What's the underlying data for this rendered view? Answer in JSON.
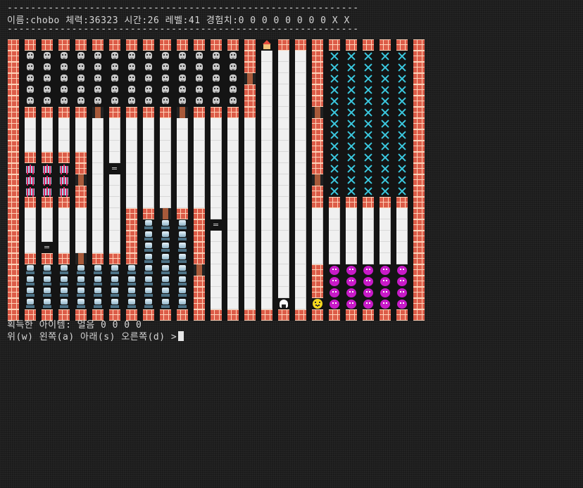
{
  "terminal": {
    "separator": "------------------------------------------------------------",
    "status_line": "이름:chobo 체력:36323 시간:26 레벨:41 경험치:0 0 0 0 0 0 0 0 X X",
    "items_line": "획득한 아이템: 얼음 0 0 0 0",
    "prompt": "위(w) 왼쪽(a) 아래(s) 오른쪽(d) >"
  },
  "legend": {
    "W": "brick-wall-icon",
    "F": "floor-tile",
    ".": "empty-dark",
    "D": "door-icon",
    "K": "skull-icon",
    "G": "gift-icon",
    "L": "lamp-icon",
    "X": "sword-icon",
    "M": "devil-icon",
    "P": "smiley-player-icon",
    "R": "rice-ball-icon",
    "H": "house-icon",
    "S": "sign-icon"
  },
  "colors": {
    "background": "#1d1d1d",
    "text": "#d6d6d6",
    "brick": "#dc5c48",
    "devil": "#c81ac8",
    "sword": "#3bc9e0",
    "player": "#f5d81e"
  },
  "map": [
    "WWWWWWWWWWWWWWWHWWWWWWWWW",
    "WKKKKKKKKKKKKKWFFFWXXXXXW",
    "WKKKKKKKKKKKKKWFFFWXXXXXW",
    "WKKKKKKKKKKKKKDFFFWXXXXXW",
    "WKKKKKKKKKKKKKWFFFWXXXXXW",
    "WKKKKKKKKKKKKKWFFFWXXXXXW",
    "WWWWWDWWWWDWWWWFFFDXXXXXW",
    "WFFFFFFFFFFFFFFFFFWXXXXXW",
    "WFFFFFFFFFFFFFFFFFWXXXXXW",
    "WFFFFFFFFFFFFFFFFFWXXXXXW",
    "WWWWWFFFFFFFFFFFFFWXXXXXW",
    "WGGGWFSFFFFFFFFFFFWXXXXXW",
    "WGGGDFFFFFFFFFFFFFDXXXXXW",
    "WGGGWFFFFFFFFFFFFFWXXXXXW",
    "WWWWWFFFFFFFFFFFFFWWWWWWW",
    "WFFFFFFWWDWWFFFFFFFFFFFFW",
    "WFFFFFFWLLLWSFFFFFFFFFFFW",
    "WFFFFFFWLLLWFFFFFFFFFFFFW",
    "WFSFFFFWLLLWFFFFFFFFFFFFW",
    "WWWWDWWWLLLWFFFFFFFFFFFFW",
    "WLLLLLLLLLLDFFFFFFWMMMMMW",
    "WLLLLLLLLLLWFFFFFFWMMMMMW",
    "WLLLLLLLLLLWFFFFFFWMMMMMW",
    "WLLLLLLLLLLWFFFFRFPMMMMMW",
    "WWWWWWWWWWWWWWWWWWWWWWWWW"
  ]
}
